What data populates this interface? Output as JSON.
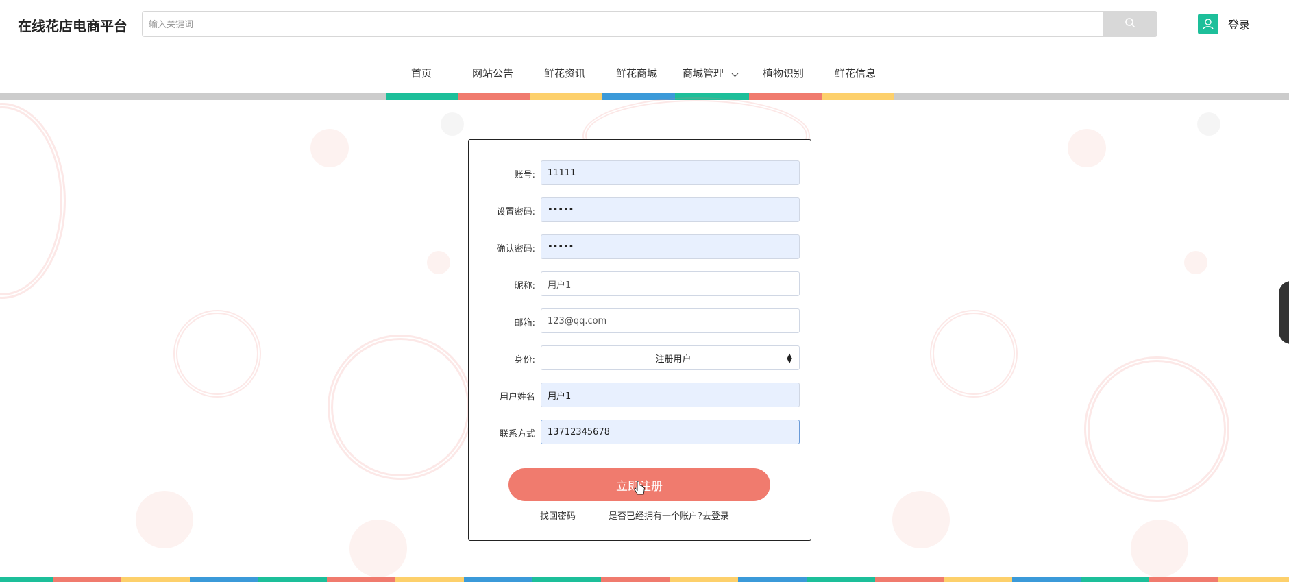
{
  "header": {
    "title": "在线花店电商平台",
    "search_placeholder": "输入关键词",
    "login_label": "登录"
  },
  "nav": {
    "items": [
      "首页",
      "网站公告",
      "鲜花资讯",
      "鲜花商城",
      "商城管理",
      "植物识别",
      "鲜花信息"
    ]
  },
  "colors": {
    "teal": "#1dbf9a",
    "coral": "#f07b6e",
    "yellow": "#fdd06b",
    "blue": "#3b9ad9"
  },
  "form": {
    "fields": [
      {
        "label": "账号:",
        "value": "11111"
      },
      {
        "label": "设置密码:",
        "value": "11111"
      },
      {
        "label": "确认密码:",
        "value": "11111"
      },
      {
        "label": "昵称:",
        "value": "用户1"
      },
      {
        "label": "邮箱:",
        "value": "123@qq.com"
      },
      {
        "label": "身份:",
        "value": "注册用户"
      },
      {
        "label": "用户姓名",
        "value": "用户1"
      },
      {
        "label": "联系方式",
        "value": "13712345678"
      }
    ],
    "submit_label": "立即注册",
    "forgot_label": "找回密码",
    "login_link_label": "是否已经拥有一个账户?去登录"
  }
}
